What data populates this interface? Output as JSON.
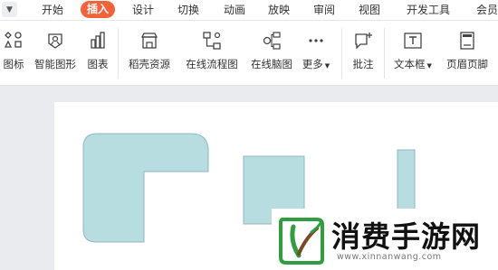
{
  "menu": {
    "tabs": [
      "开始",
      "插入",
      "设计",
      "切换",
      "动画",
      "放映",
      "审阅",
      "视图",
      "开发工具",
      "会员"
    ],
    "active": "插入",
    "accent": "#f4623a"
  },
  "ribbon": {
    "tools": [
      {
        "id": "icon",
        "label": "图标",
        "icon": "shapes-icon"
      },
      {
        "id": "smartart",
        "label": "智能图形",
        "icon": "smart-graphic-icon"
      },
      {
        "id": "chart",
        "label": "图表",
        "icon": "bar-chart-icon"
      },
      {
        "id": "resources",
        "label": "稻壳资源",
        "icon": "store-icon"
      },
      {
        "id": "flowchart",
        "label": "在线流程图",
        "icon": "flowchart-icon"
      },
      {
        "id": "mindmap",
        "label": "在线脑图",
        "icon": "mindmap-icon"
      },
      {
        "id": "more",
        "label": "更多",
        "icon": "more-dots-icon"
      },
      {
        "id": "comment",
        "label": "批注",
        "icon": "comment-add-icon"
      },
      {
        "id": "textbox",
        "label": "文本框",
        "icon": "textbox-icon"
      },
      {
        "id": "header",
        "label": "页眉页脚",
        "icon": "header-footer-icon"
      }
    ]
  },
  "slide": {
    "shape_fill": "#b8dde0",
    "shape_stroke": "#8fb8bc"
  },
  "watermark": {
    "title": "消费手游网",
    "url": "www.xinnanwang.com"
  }
}
